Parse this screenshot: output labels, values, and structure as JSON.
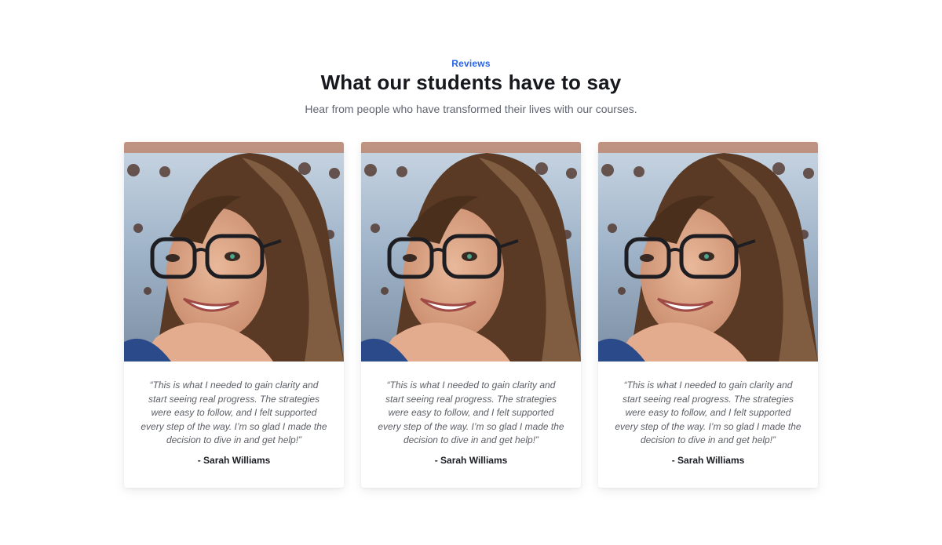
{
  "header": {
    "eyebrow": "Reviews",
    "title": "What our students have to say",
    "subtitle": "Hear from people who have transformed their lives with our courses."
  },
  "reviews": [
    {
      "quote": "“This is what I needed to gain clarity and start seeing real progress. The strategies were easy to follow, and I felt supported every step of the way. I’m so glad I made the decision to dive in and get help!”",
      "author": "- Sarah Williams",
      "photo_icon": "student-portrait-photo"
    },
    {
      "quote": "“This is what I needed to gain clarity and start seeing real progress. The strategies were easy to follow, and I felt supported every step of the way. I’m so glad I made the decision to dive in and get help!”",
      "author": "- Sarah Williams",
      "photo_icon": "student-portrait-photo"
    },
    {
      "quote": "“This is what I needed to gain clarity and start seeing real progress. The strategies were easy to follow, and I felt supported every step of the way. I’m so glad I made the decision to dive in and get help!”",
      "author": "- Sarah Williams",
      "photo_icon": "student-portrait-photo"
    }
  ],
  "colors": {
    "accent": "#2563eb",
    "heading": "#16181d",
    "body_text": "#5f6470"
  }
}
